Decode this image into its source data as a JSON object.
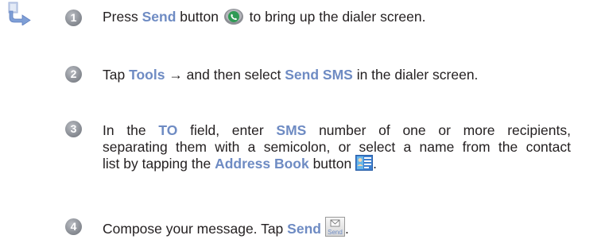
{
  "icons": {
    "section_arrow": "arrow-right-icon",
    "send_phone": "phone-send-icon",
    "address_book": "address-book-icon",
    "send_message": "send-message-icon"
  },
  "colors": {
    "highlight": "#6e8bc3",
    "badge": "#8e9299",
    "text": "#231f20"
  },
  "steps": [
    {
      "number": "1",
      "parts": [
        "Press ",
        "Send",
        " button ",
        " to bring up the dialer screen."
      ]
    },
    {
      "number": "2",
      "parts": [
        "Tap ",
        "Tools",
        " → and then select ",
        "Send SMS",
        " in the dialer screen."
      ]
    },
    {
      "number": "3",
      "parts": [
        "In the ",
        "TO",
        " field, enter ",
        "SMS",
        " number of one or more recipients,",
        "separating them with a semicolon, or select a name from the contact",
        "list by tapping the ",
        "Address Book",
        " button ",
        "."
      ]
    },
    {
      "number": "4",
      "parts": [
        "Compose your message.  Tap ",
        "Send",
        ".",
        "Send"
      ]
    }
  ]
}
